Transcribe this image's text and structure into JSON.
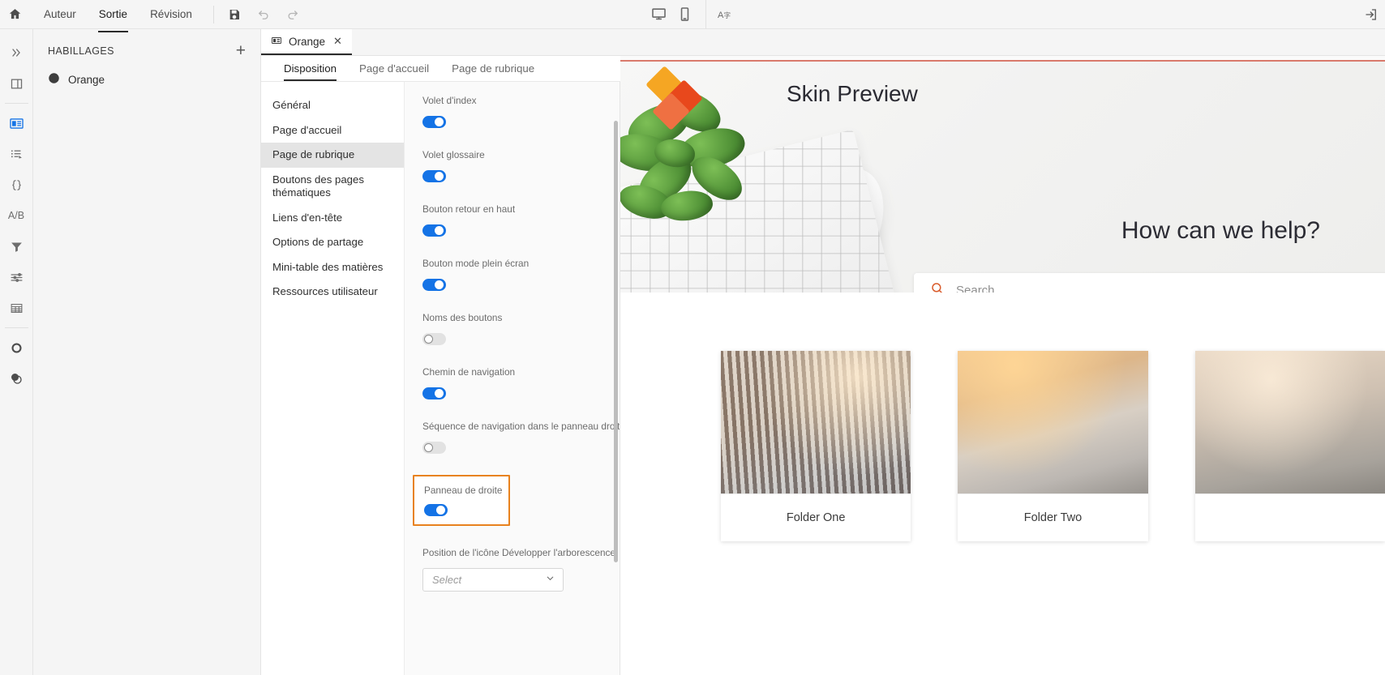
{
  "topbar": {
    "home_icon": "home-icon",
    "menu": [
      {
        "label": "Auteur",
        "active": false
      },
      {
        "label": "Sortie",
        "active": true
      },
      {
        "label": "Révision",
        "active": false
      }
    ],
    "actions": [
      {
        "name": "save-icon",
        "label": ""
      },
      {
        "name": "undo-icon",
        "label": ""
      },
      {
        "name": "redo-icon",
        "label": ""
      }
    ],
    "center_actions": [
      {
        "name": "desktop-preview-icon"
      },
      {
        "name": "mobile-preview-icon"
      },
      {
        "name": "translate-icon"
      }
    ],
    "right_action": {
      "name": "exit-icon"
    }
  },
  "rail": {
    "items": [
      {
        "name": "expand-rail-icon",
        "selected": false
      },
      {
        "name": "layout-icon",
        "selected": false
      },
      {
        "name": "skins-icon",
        "selected": true
      },
      {
        "name": "toc-icon",
        "selected": false
      },
      {
        "name": "variables-icon",
        "selected": false
      },
      {
        "name": "ab-test-icon",
        "selected": false
      },
      {
        "name": "filter-icon",
        "selected": false
      },
      {
        "name": "settings-sliders-icon",
        "selected": false
      },
      {
        "name": "table-icon",
        "selected": false
      },
      {
        "name": "publish-icon",
        "selected": false
      },
      {
        "name": "overlay-icon",
        "selected": false
      }
    ]
  },
  "skins_panel": {
    "title": "HABILLAGES",
    "add_label": "+",
    "items": [
      {
        "label": "Orange",
        "icon": "globe-icon"
      }
    ]
  },
  "editor": {
    "document_tab": {
      "label": "Orange",
      "icon": "skin-icon",
      "close_label": "✕"
    },
    "subtabs": [
      {
        "label": "Disposition",
        "active": true
      },
      {
        "label": "Page d'accueil",
        "active": false
      },
      {
        "label": "Page de rubrique",
        "active": false
      }
    ],
    "nav_items": [
      {
        "label": "Général",
        "selected": false
      },
      {
        "label": "Page d'accueil",
        "selected": false
      },
      {
        "label": "Page de rubrique",
        "selected": true
      },
      {
        "label": "Boutons des pages thématiques",
        "selected": false
      },
      {
        "label": "Liens d'en-tête",
        "selected": false
      },
      {
        "label": "Options de partage",
        "selected": false
      },
      {
        "label": "Mini-table des matières",
        "selected": false
      },
      {
        "label": "Ressources utilisateur",
        "selected": false
      }
    ],
    "properties": [
      {
        "label": "Volet d'index",
        "type": "toggle",
        "value": true,
        "highlighted": false
      },
      {
        "label": "Volet glossaire",
        "type": "toggle",
        "value": true,
        "highlighted": false
      },
      {
        "label": "Bouton retour en haut",
        "type": "toggle",
        "value": true,
        "highlighted": false
      },
      {
        "label": "Bouton mode plein écran",
        "type": "toggle",
        "value": true,
        "highlighted": false
      },
      {
        "label": "Noms des boutons",
        "type": "toggle",
        "value": false,
        "highlighted": false
      },
      {
        "label": "Chemin de navigation",
        "type": "toggle",
        "value": true,
        "highlighted": false
      },
      {
        "label": "Séquence de navigation dans le panneau droit",
        "type": "toggle",
        "value": false,
        "highlighted": false
      },
      {
        "label": "Panneau de droite",
        "type": "toggle",
        "value": true,
        "highlighted": true
      },
      {
        "label": "Position de l'icône Développer l'arborescence",
        "type": "select",
        "value": "Select",
        "highlighted": false
      }
    ],
    "highlight_color": "#e8821e"
  },
  "preview": {
    "hero_title": "Skin Preview",
    "help_title": "How can we help?",
    "search_placeholder": "Search...",
    "search_icon": "search-icon",
    "search_icon_color": "#d95b2b",
    "logo": {
      "name": "diamond-logo",
      "colors": [
        "#f5a623",
        "#e8481c",
        "#ef7042"
      ]
    },
    "cards": [
      {
        "label": "Folder One"
      },
      {
        "label": "Folder Two"
      },
      {
        "label": ""
      }
    ]
  }
}
